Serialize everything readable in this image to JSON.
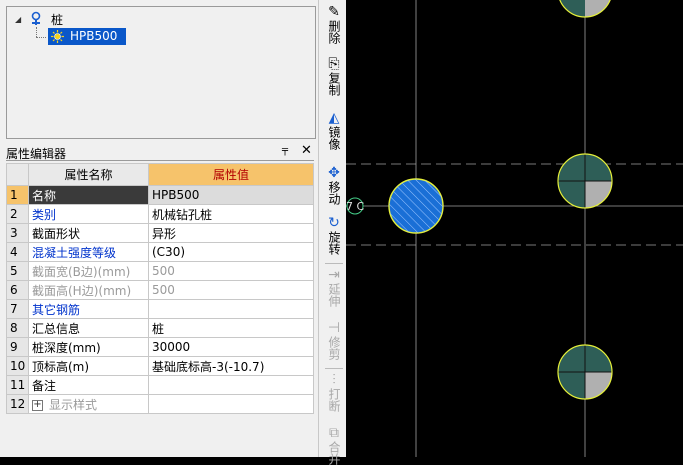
{
  "tree": {
    "root_label": "桩",
    "child_label": "HPB500"
  },
  "property_editor": {
    "title": "属性编辑器",
    "pin_icon": "pin-icon",
    "close_icon": "close-icon",
    "headers": {
      "name": "属性名称",
      "value": "属性值"
    },
    "rows": [
      {
        "num": "1",
        "name": "名称",
        "value": "HPB500",
        "style": "normal",
        "selected": true
      },
      {
        "num": "2",
        "name": "类别",
        "value": "机械钻孔桩",
        "style": "blue"
      },
      {
        "num": "3",
        "name": "截面形状",
        "value": "异形",
        "style": "normal"
      },
      {
        "num": "4",
        "name": "混凝土强度等级",
        "value": "(C30)",
        "style": "blue"
      },
      {
        "num": "5",
        "name": "截面宽(B边)(mm)",
        "value": "500",
        "style": "gray"
      },
      {
        "num": "6",
        "name": "截面高(H边)(mm)",
        "value": "500",
        "style": "gray"
      },
      {
        "num": "7",
        "name": "其它钢筋",
        "value": "",
        "style": "blue"
      },
      {
        "num": "8",
        "name": "汇总信息",
        "value": "桩",
        "style": "normal"
      },
      {
        "num": "9",
        "name": "桩深度(mm)",
        "value": "30000",
        "style": "normal"
      },
      {
        "num": "10",
        "name": "顶标高(m)",
        "value": "基础底标高-3(-10.7)",
        "style": "normal"
      },
      {
        "num": "11",
        "name": "备注",
        "value": "",
        "style": "normal"
      },
      {
        "num": "12",
        "name": "显示样式",
        "value": "",
        "style": "gray",
        "expandable": true
      }
    ]
  },
  "toolbar": {
    "tools": [
      {
        "label": "删除",
        "icon": "eraser-icon",
        "enabled": true
      },
      {
        "label": "复制",
        "icon": "copy-icon",
        "enabled": true
      },
      {
        "label": "镜像",
        "icon": "mirror-icon",
        "enabled": true
      },
      {
        "label": "移动",
        "icon": "move-icon",
        "enabled": true
      },
      {
        "label": "旋转",
        "icon": "rotate-icon",
        "enabled": true
      },
      {
        "label": "延伸",
        "icon": "extend-icon",
        "enabled": false
      },
      {
        "label": "修剪",
        "icon": "trim-icon",
        "enabled": false
      },
      {
        "label": "打断",
        "icon": "break-icon",
        "enabled": false
      },
      {
        "label": "合并",
        "icon": "merge-icon",
        "enabled": false
      }
    ]
  },
  "canvas": {
    "axis_label": "7 C",
    "background": "#000000",
    "pile_fill": "#2e5e57",
    "pile_outline": "#e6f03a",
    "selected_pile_fill": "#1a6fd6",
    "grid_line_color": "#a0a0a0"
  }
}
